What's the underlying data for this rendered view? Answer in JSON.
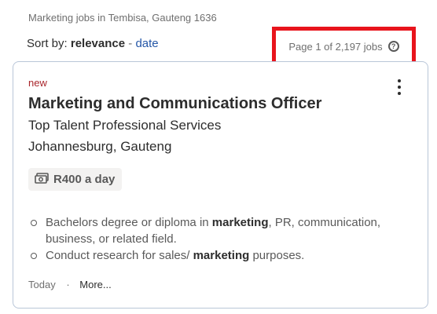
{
  "results_header": "Marketing jobs in Tembisa, Gauteng 1636",
  "sort": {
    "prefix": "Sort by:",
    "current": "relevance",
    "separator": "-",
    "alternative": "date"
  },
  "page_count": "Page 1 of 2,197 jobs",
  "help_icon": "question-circle-icon",
  "job": {
    "new_label": "new",
    "title": "Marketing and Communications Officer",
    "company": "Top Talent Professional Services",
    "location": "Johannesburg, Gauteng",
    "salary": "R400 a day",
    "salary_icon": "money-icon",
    "menu_icon": "kebab-menu-icon",
    "snippet": [
      {
        "before": "Bachelors degree or diploma in ",
        "keyword": "marketing",
        "after": ", PR, communication, business, or related field."
      },
      {
        "before": "Conduct research for sales/ ",
        "keyword": "marketing",
        "after": " purposes."
      }
    ],
    "posted": "Today",
    "footer_sep": "·",
    "more_label": "More..."
  },
  "colors": {
    "highlight_border": "#e8141c",
    "link_blue": "#2557a7",
    "new_red": "#a9252b",
    "card_border": "#b9c6d8"
  }
}
